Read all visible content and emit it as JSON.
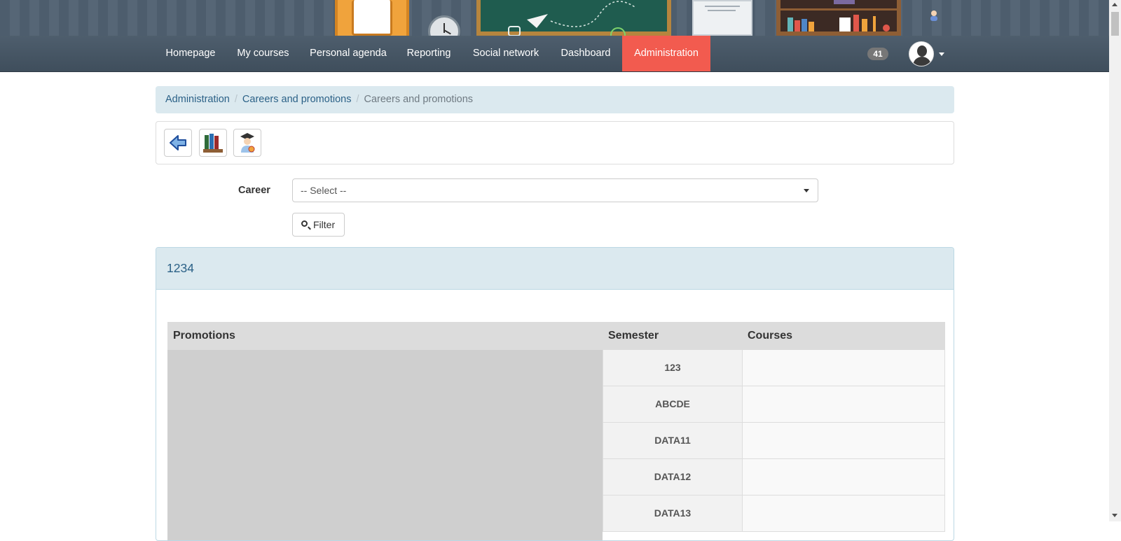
{
  "nav": {
    "items": [
      {
        "label": "Homepage"
      },
      {
        "label": "My courses"
      },
      {
        "label": "Personal agenda"
      },
      {
        "label": "Reporting"
      },
      {
        "label": "Social network"
      },
      {
        "label": "Dashboard"
      },
      {
        "label": "Administration",
        "active": true
      }
    ],
    "notification_count": "41"
  },
  "breadcrumb": {
    "items": [
      "Administration",
      "Careers and promotions"
    ],
    "current": "Careers and promotions"
  },
  "toolbar": {
    "icons": [
      "back-arrow-icon",
      "books-icon",
      "graduate-icon"
    ]
  },
  "form": {
    "career_label": "Career",
    "career_value": "-- Select --",
    "filter_label": "Filter"
  },
  "panel": {
    "title": "1234",
    "table": {
      "headers": [
        "Promotions",
        "Semester",
        "Courses"
      ],
      "semesters": [
        "123",
        "ABCDE",
        "DATA11",
        "DATA12",
        "DATA13"
      ]
    }
  },
  "colors": {
    "nav_active": "#f25b4f",
    "link": "#2b6187",
    "panel_heading": "#dbe9ef"
  }
}
